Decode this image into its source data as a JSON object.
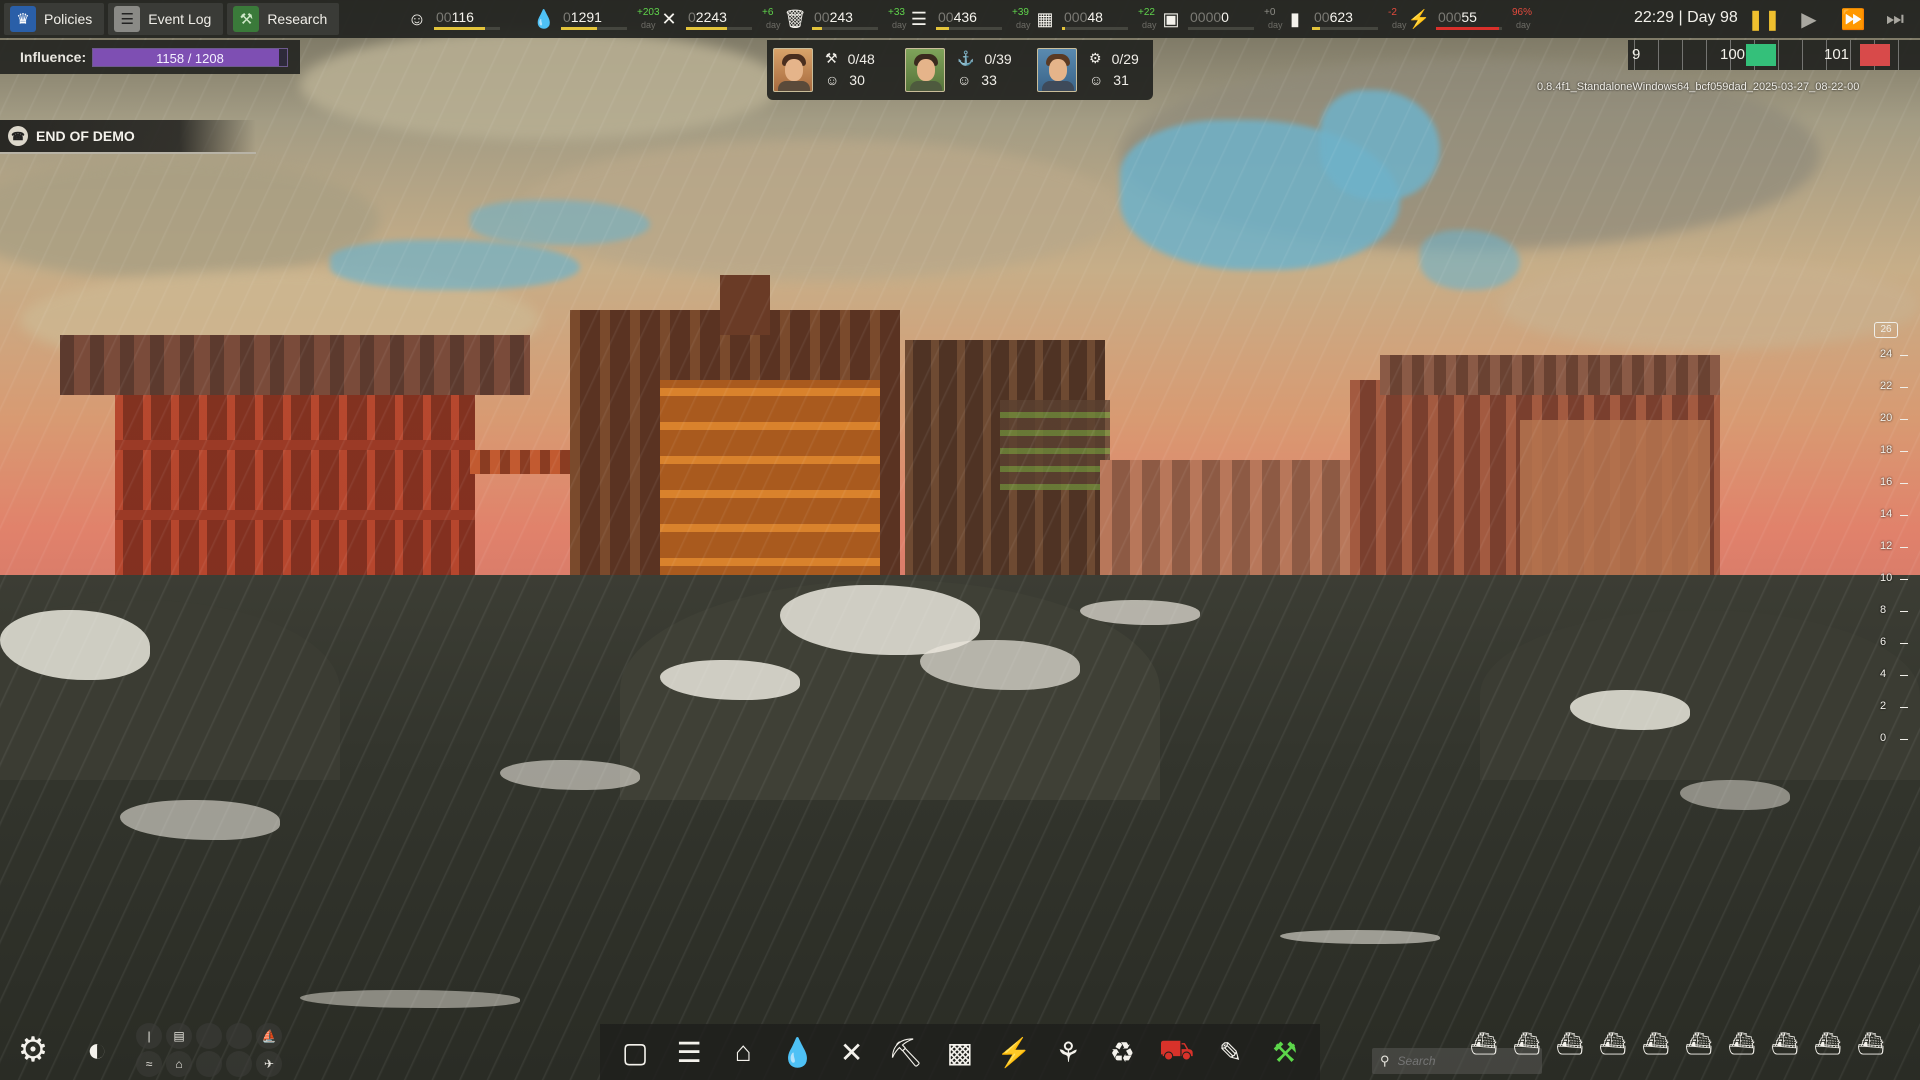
{
  "menu": [
    {
      "label": "Policies",
      "icon": "policies-icon"
    },
    {
      "label": "Event Log",
      "icon": "event-log-icon"
    },
    {
      "label": "Research",
      "icon": "research-icon"
    }
  ],
  "resources": [
    {
      "id": "population",
      "icon": "population-icon",
      "zeros": "00",
      "value": "116",
      "delta": "",
      "day": "",
      "fill": 0.78,
      "fill_color": "#e3c43b"
    },
    {
      "id": "water",
      "icon": "water-icon",
      "zeros": "0",
      "value": "1291",
      "delta": "+203",
      "day": "day",
      "fill": 0.55,
      "fill_color": "#e3c43b"
    },
    {
      "id": "food",
      "icon": "food-icon",
      "zeros": "0",
      "value": "2243",
      "delta": "+6",
      "day": "day",
      "fill": 0.62,
      "fill_color": "#e3c43b"
    },
    {
      "id": "scrap",
      "icon": "scrap-icon",
      "zeros": "00",
      "value": "243",
      "delta": "+33",
      "day": "day",
      "fill": 0.15,
      "fill_color": "#e3c43b"
    },
    {
      "id": "wood",
      "icon": "wood-icon",
      "zeros": "00",
      "value": "436",
      "delta": "+39",
      "day": "day",
      "fill": 0.2,
      "fill_color": "#e3c43b"
    },
    {
      "id": "fabric",
      "icon": "fabric-icon",
      "zeros": "000",
      "value": "48",
      "delta": "+22",
      "day": "day",
      "fill": 0.05,
      "fill_color": "#e3c43b"
    },
    {
      "id": "goods",
      "icon": "goods-icon",
      "zeros": "0000",
      "value": "0",
      "delta": "+0",
      "day": "day",
      "fill": 0.0,
      "fill_color": "#e3c43b"
    },
    {
      "id": "fuel",
      "icon": "fuel-icon",
      "zeros": "00",
      "value": "623",
      "delta": "-2",
      "day": "day",
      "fill": 0.12,
      "fill_color": "#e3c43b"
    },
    {
      "id": "power",
      "icon": "power-icon",
      "zeros": "000",
      "value": "55",
      "delta": "96%",
      "day": "day",
      "fill": 0.96,
      "fill_color": "#d9302b"
    }
  ],
  "clock": "22:29 | Day 98",
  "time_controls": [
    "pause-icon",
    "play-icon",
    "fast-forward-icon",
    "fastest-icon"
  ],
  "influence": {
    "label": "Influence:",
    "text": "1158 / 1208",
    "value": 1158,
    "max": 1208
  },
  "workers": [
    {
      "role_icon": "builder-icon",
      "assigned": "0/48",
      "mood": "30"
    },
    {
      "role_icon": "dock-worker-icon",
      "assigned": "0/39",
      "mood": "33"
    },
    {
      "role_icon": "scientist-icon",
      "assigned": "0/29",
      "mood": "31"
    }
  ],
  "demo_banner": "END OF DEMO",
  "timeline": {
    "left_num": "9",
    "mid_num": "100",
    "right_num": "101"
  },
  "version": "0.8.4f1_StandaloneWindows64_bcf059dad_2025-03-27_08-22-00",
  "wave_scale": {
    "top": "26",
    "ticks": [
      "24",
      "22",
      "20",
      "18",
      "16",
      "14",
      "12",
      "10",
      "8",
      "6",
      "4",
      "2",
      "0"
    ]
  },
  "bottom_left": {
    "settings_icon": "gear-icon",
    "overlay_icon": "overlay-toggle-icon",
    "small_icons": [
      "info-icon",
      "card-icon",
      "blank-icon",
      "blank-icon",
      "ship-icon",
      "wave-icon",
      "building-icon",
      "blank-icon",
      "blank-icon",
      "plane-icon"
    ]
  },
  "build_menu": [
    "select-area-icon",
    "platform-icon",
    "house-icon",
    "water-drop-icon",
    "food-cutlery-icon",
    "cart-icon",
    "factory-icon",
    "lightning-icon",
    "plant-icon",
    "recycle-icon",
    "bulldozer-icon",
    "paint-brush-icon",
    "hammer-icon"
  ],
  "search": {
    "placeholder": "Search"
  },
  "boats_count": 10
}
